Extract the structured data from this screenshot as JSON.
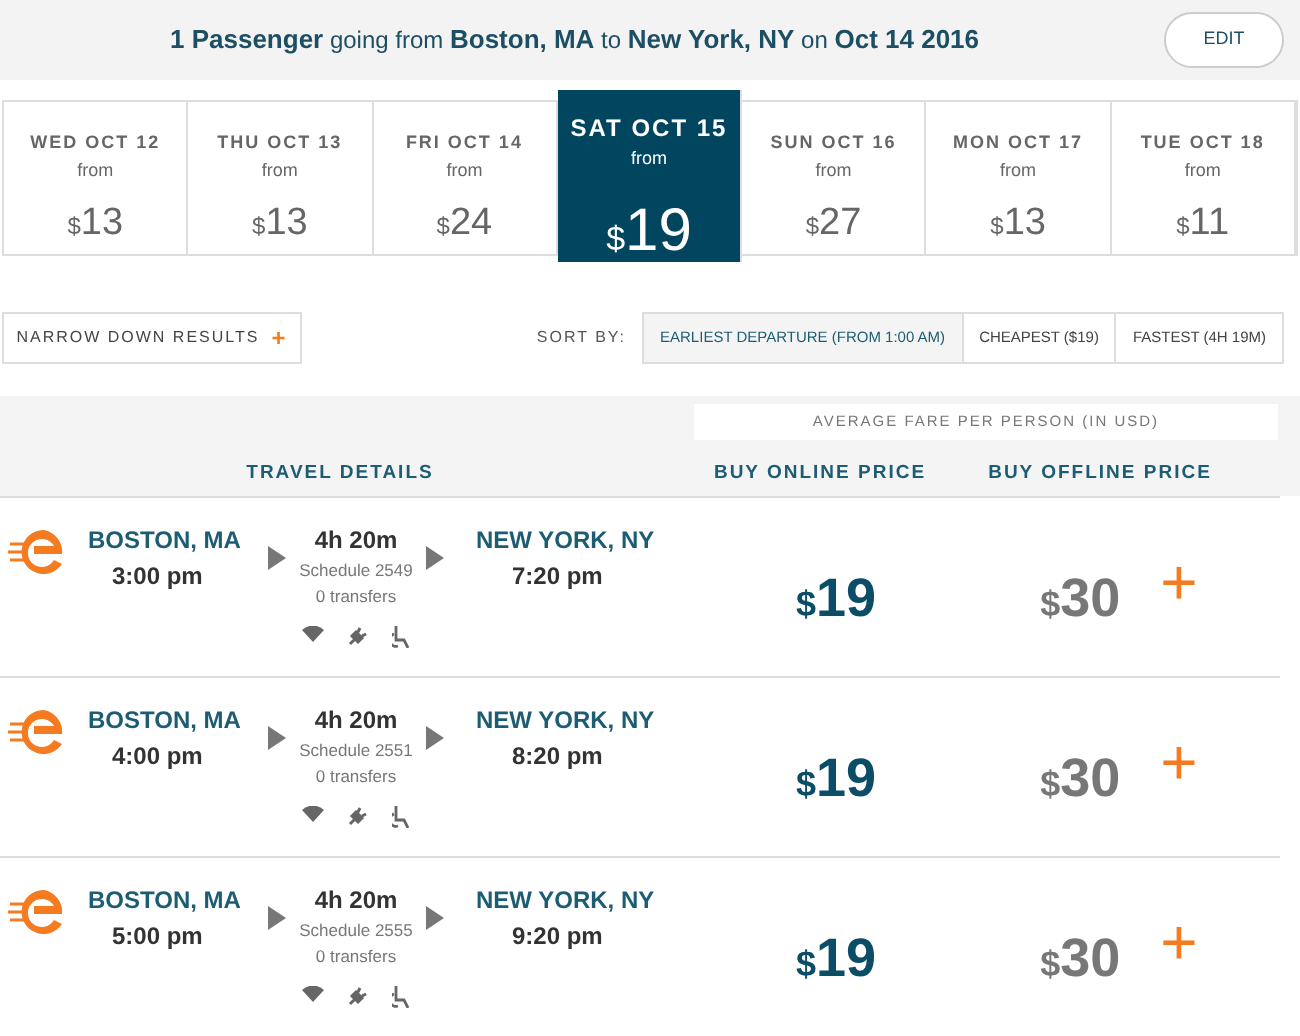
{
  "summary": "**1 Passenger** going from **Boston, MA** to **New York, NY** on **Oct 14 2016**",
  "edit_button": "EDIT",
  "dates": [
    {
      "day": "WED OCT 12",
      "from": "from",
      "currency": "$",
      "amount": "13",
      "selected": false
    },
    {
      "day": "THU OCT 13",
      "from": "from",
      "currency": "$",
      "amount": "13",
      "selected": false
    },
    {
      "day": "FRI OCT 14",
      "from": "from",
      "currency": "$",
      "amount": "24",
      "selected": false
    },
    {
      "day": "SAT OCT 15",
      "from": "from",
      "currency": "$",
      "amount": "19",
      "selected": true
    },
    {
      "day": "SUN OCT 16",
      "from": "from",
      "currency": "$",
      "amount": "27",
      "selected": false
    },
    {
      "day": "MON OCT 17",
      "from": "from",
      "currency": "$",
      "amount": "13",
      "selected": false
    },
    {
      "day": "TUE OCT 18",
      "from": "from",
      "currency": "$",
      "amount": "11",
      "selected": false
    }
  ],
  "narrow_button": {
    "label": "NARROW DOWN RESULTS",
    "icon": "+"
  },
  "sort": {
    "label": "SORT BY:",
    "options": [
      {
        "label": "EARLIEST DEPARTURE (FROM 1:00 AM)",
        "selected": true
      },
      {
        "label": "CHEAPEST ($19)",
        "selected": false
      },
      {
        "label": "FASTEST (4H 19M)",
        "selected": false
      }
    ]
  },
  "table": {
    "fare_note": "AVERAGE FARE PER PERSON (IN USD)",
    "columns": [
      "TRAVEL DETAILS",
      "BUY ONLINE PRICE",
      "BUY OFFLINE PRICE"
    ],
    "rows": [
      {
        "origin": "BOSTON, MA",
        "depart": "3:00 pm",
        "duration": "4h 20m",
        "schedule": "Schedule 2549",
        "transfers": "0 transfers",
        "destination": "NEW YORK, NY",
        "arrive": "7:20 pm",
        "online_currency": "$",
        "online_amount": "19",
        "offline_currency": "$",
        "offline_amount": "30",
        "add": "+"
      },
      {
        "origin": "BOSTON, MA",
        "depart": "4:00 pm",
        "duration": "4h 20m",
        "schedule": "Schedule 2551",
        "transfers": "0 transfers",
        "destination": "NEW YORK, NY",
        "arrive": "8:20 pm",
        "online_currency": "$",
        "online_amount": "19",
        "offline_currency": "$",
        "offline_amount": "30",
        "add": "+"
      },
      {
        "origin": "BOSTON, MA",
        "depart": "5:00 pm",
        "duration": "4h 20m",
        "schedule": "Schedule 2555",
        "transfers": "0 transfers",
        "destination": "NEW YORK, NY",
        "arrive": "9:20 pm",
        "online_currency": "$",
        "online_amount": "19",
        "offline_currency": "$",
        "offline_amount": "30",
        "add": "+"
      }
    ]
  }
}
